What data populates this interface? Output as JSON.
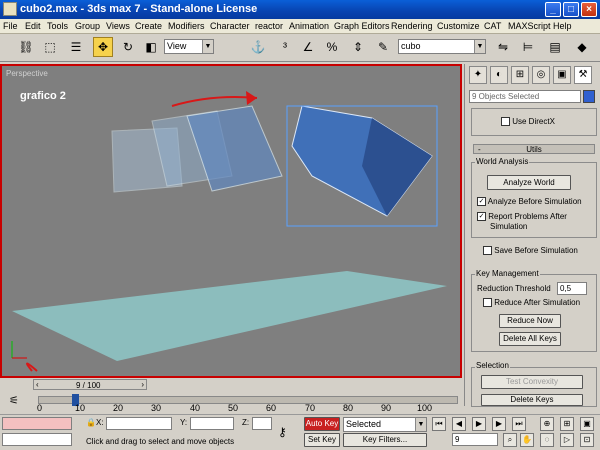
{
  "window": {
    "title": "cubo2.max - 3ds max 7 - Stand-alone License",
    "controls": [
      "_",
      "□",
      "×"
    ]
  },
  "menu": [
    "File",
    "Edit",
    "Tools",
    "Group",
    "Views",
    "Create",
    "Modifiers",
    "Character",
    "reactor",
    "Animation",
    "Graph Editors",
    "Rendering",
    "Customize",
    "CAT",
    "MAXScript",
    "Help"
  ],
  "toolbar": {
    "ref_coord": "View",
    "named_selection": "cubo"
  },
  "viewport": {
    "label": "Perspective",
    "annotation": "grafico 2"
  },
  "command_panel": {
    "selection_info": "9 Objects Selected",
    "use_directx": "Use DirectX",
    "rollout_toggle": "-",
    "rollout_title": "Utils",
    "world_analysis": {
      "label": "World Analysis",
      "analyze_button": "Analyze World",
      "analyze_before_sim": "Analyze Before Simulation",
      "report_problems": "Report Problems After",
      "report_problems_2": "Simulation"
    },
    "save_before_sim": "Save Before Simulation",
    "key_management": {
      "label": "Key Management",
      "reduction_threshold_label": "Reduction Threshold",
      "reduction_threshold_value": "0,5",
      "reduce_after_sim": "Reduce After Simulation",
      "reduce_now": "Reduce Now",
      "delete_all_keys": "Delete All Keys"
    },
    "selection": {
      "label": "Selection",
      "test_convexity": "Test Convexity",
      "delete_keys": "Delete Keys"
    }
  },
  "timeline": {
    "frame": "9 / 100",
    "ticks": [
      "0",
      "10",
      "20",
      "30",
      "40",
      "50",
      "60",
      "70",
      "80",
      "90",
      "100"
    ]
  },
  "status": {
    "x_label": "X:",
    "y_label": "Y:",
    "z_label": "Z:",
    "auto_key": "Auto Key",
    "set_key": "Set Key",
    "selected": "Selected",
    "key_filters": "Key Filters...",
    "prompt": "Click and drag to select and move objects",
    "current_frame": "9"
  },
  "colors": {
    "accent_red": "#c80000",
    "title_blue": "#0843b0",
    "cube_blue": "#4070b8",
    "ground": "#8ec8c8"
  }
}
